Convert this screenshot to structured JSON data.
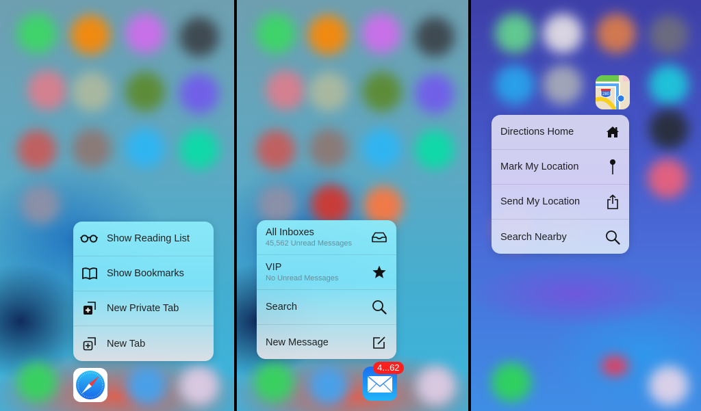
{
  "panels": [
    {
      "app": "Safari",
      "menu_items": [
        {
          "label": "Show Reading List",
          "icon": "glasses-icon"
        },
        {
          "label": "Show Bookmarks",
          "icon": "book-icon"
        },
        {
          "label": "New Private Tab",
          "icon": "private-tab-icon"
        },
        {
          "label": "New Tab",
          "icon": "new-tab-icon"
        }
      ]
    },
    {
      "app": "Mail",
      "badge": "4...62",
      "menu_items": [
        {
          "label": "All Inboxes",
          "sublabel": "45,562 Unread Messages",
          "icon": "inbox-tray-icon"
        },
        {
          "label": "VIP",
          "sublabel": "No Unread Messages",
          "icon": "star-icon"
        },
        {
          "label": "Search",
          "icon": "search-icon"
        },
        {
          "label": "New Message",
          "icon": "compose-icon"
        }
      ]
    },
    {
      "app": "Maps",
      "map_shield": "280",
      "menu_items": [
        {
          "label": "Directions Home",
          "icon": "home-icon"
        },
        {
          "label": "Mark My Location",
          "icon": "pin-icon"
        },
        {
          "label": "Send My Location",
          "icon": "share-icon"
        },
        {
          "label": "Search Nearby",
          "icon": "search-icon"
        }
      ]
    }
  ],
  "colors": {
    "badge": "#ff1f1f",
    "safari_blue": "#1e7ff0",
    "mail_blue": "#1e8ef5"
  }
}
